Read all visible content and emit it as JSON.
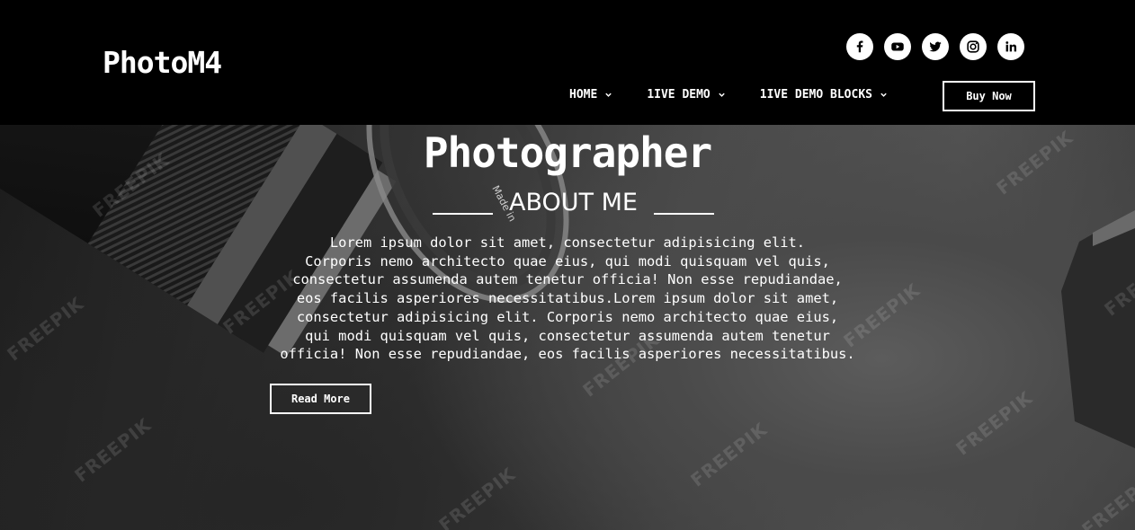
{
  "header": {
    "logo": "PhotoM4",
    "socials": [
      {
        "icon": "facebook-icon",
        "glyph": "f"
      },
      {
        "icon": "youtube-icon"
      },
      {
        "icon": "twitter-icon"
      },
      {
        "icon": "instagram-icon"
      },
      {
        "icon": "linkedin-icon",
        "glyph": "in"
      }
    ],
    "nav": [
      {
        "label": "HOME",
        "icon": "chevron-down-icon"
      },
      {
        "label": "1IVE DEMO",
        "icon": "chevron-down-icon"
      },
      {
        "label": "1IVE DEMO BLOCKS",
        "icon": "chevron-down-icon"
      }
    ],
    "buy_label": "Buy Now"
  },
  "hero": {
    "title": "Photographer",
    "subtitle": "ABOUT ME",
    "body_lines": [
      "Lorem ipsum dolor sit amet, consectetur adipisicing elit.",
      "Corporis nemo architecto quae eius, qui modi quisquam vel quis,",
      "consectetur assumenda autem tenetur officia! Non esse repudiandae,",
      "eos facilis asperiores necessitatibus.Lorem ipsum dolor sit amet,",
      "consectetur adipisicing elit. Corporis nemo architecto quae eius,",
      "qui modi quisquam vel quis, consectetur assumenda autem tenetur",
      "officia! Non esse repudiandae, eos facilis asperiores necessitatibus."
    ],
    "read_more_label": "Read More",
    "lens_text": "Made in",
    "watermark": "FREEPIK"
  },
  "colors": {
    "header_bg": "#000000",
    "text": "#ffffff"
  }
}
